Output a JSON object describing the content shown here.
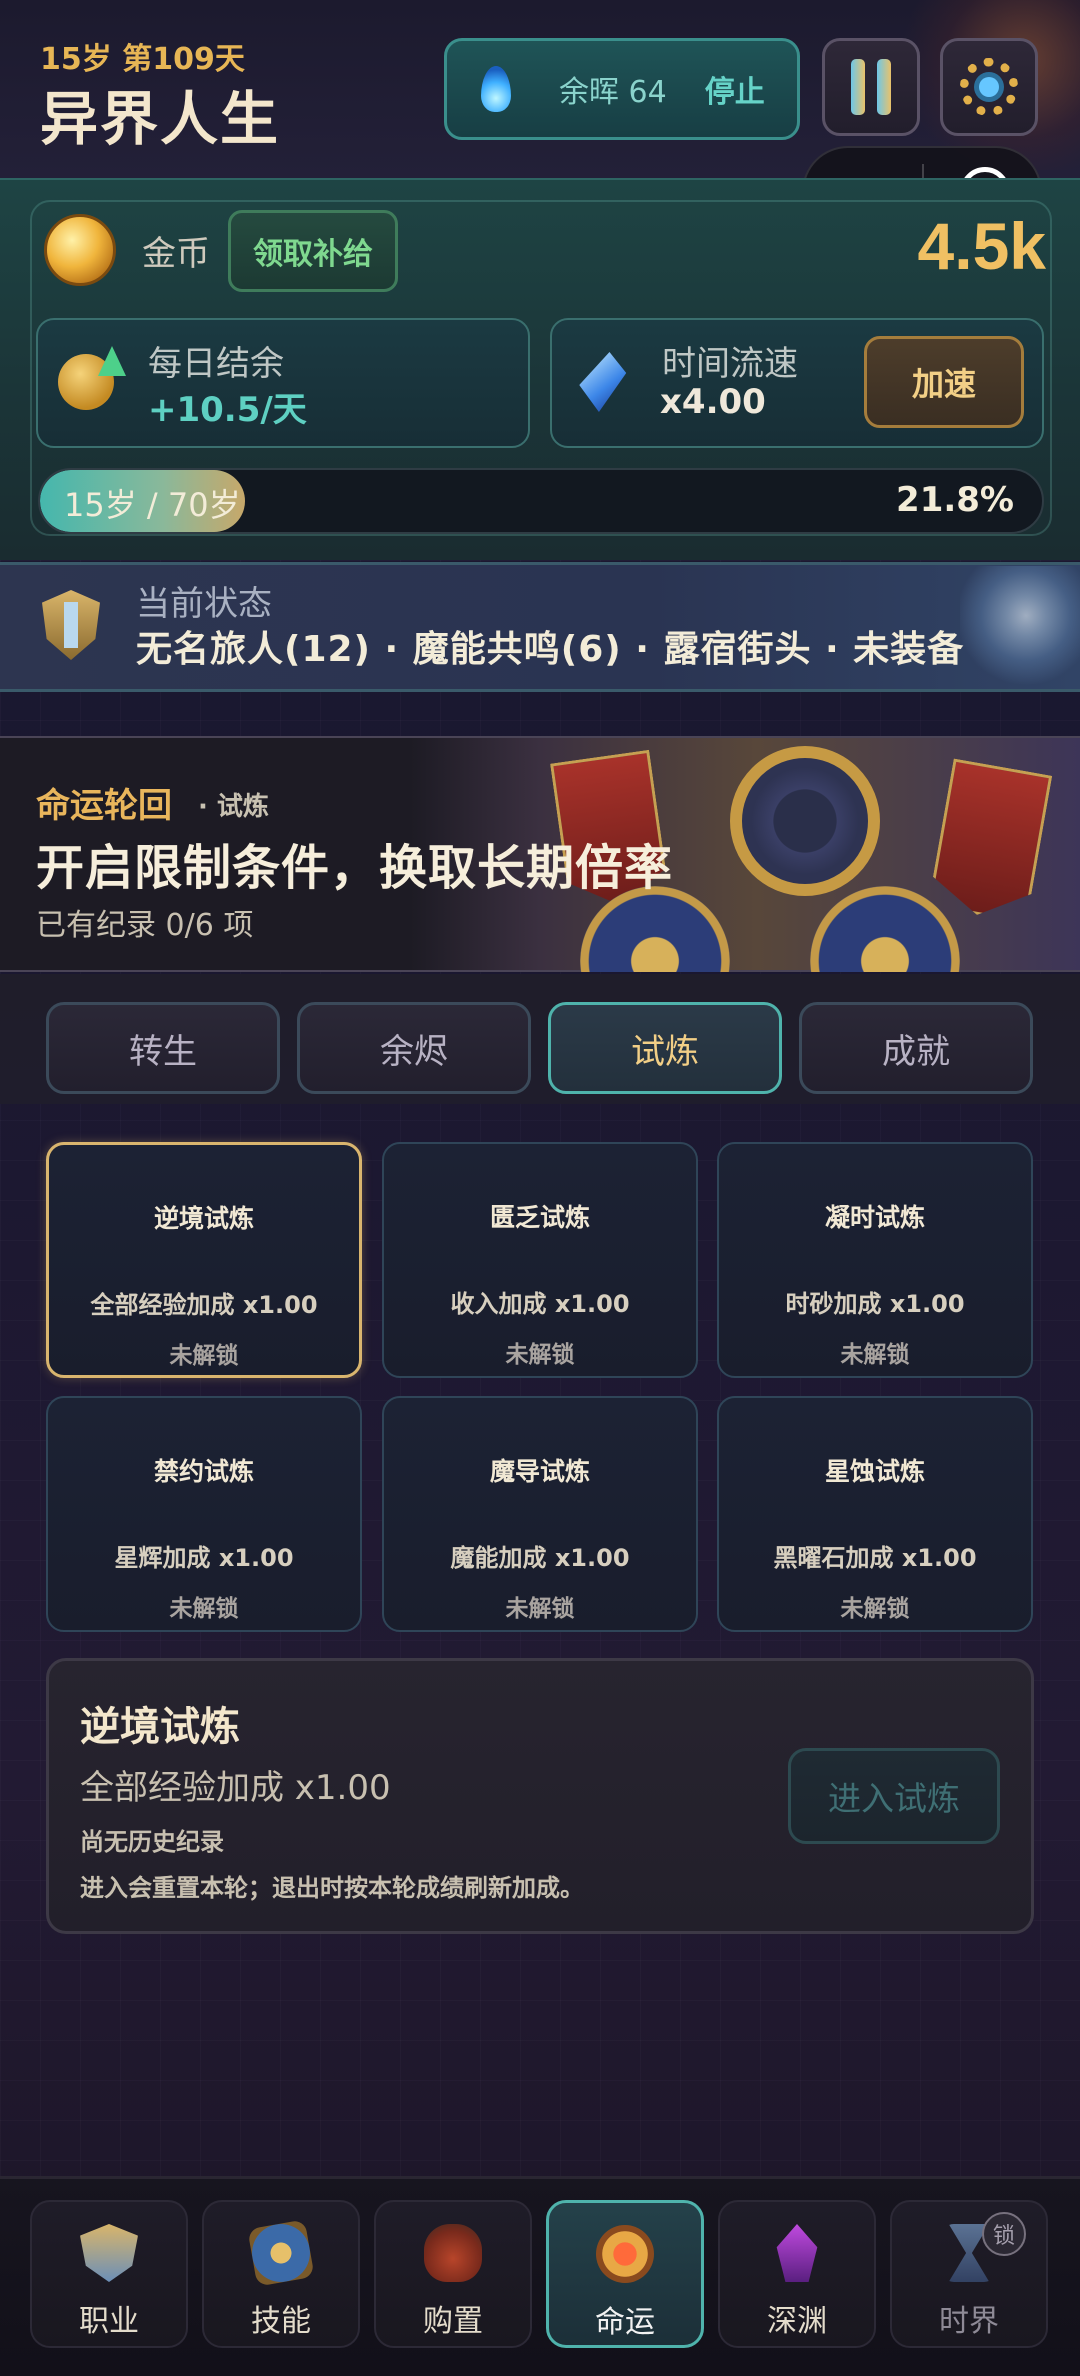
{
  "header": {
    "age_day": "15岁 第109天",
    "title": "异界人生",
    "ember_label": "余晖 64",
    "stop_label": "停止"
  },
  "gold": {
    "label": "金币",
    "claim_label": "领取补给",
    "value": "4.5k"
  },
  "daily": {
    "label": "每日结余",
    "value": "+10.5/天"
  },
  "speed": {
    "label": "时间流速",
    "value": "x4.00",
    "boost_label": "加速"
  },
  "life": {
    "text": "15岁 / 70岁",
    "percent_text": "21.8%",
    "fill_fraction": 0.205
  },
  "status": {
    "label": "当前状态",
    "value": "无名旅人(12) · 魔能共鸣(6) · 露宿街头 · 未装备"
  },
  "banner": {
    "tag": "命运轮回",
    "sub": "· 试炼",
    "title": "开启限制条件，换取长期倍率",
    "note": "已有纪录 0/6 项"
  },
  "tabs": [
    {
      "label": "转生",
      "active": false
    },
    {
      "label": "余烬",
      "active": false
    },
    {
      "label": "试炼",
      "active": true
    },
    {
      "label": "成就",
      "active": false
    }
  ],
  "trials": [
    {
      "name": "逆境试炼",
      "bonus": "全部经验加成 x1.00",
      "status": "未解锁"
    },
    {
      "name": "匮乏试炼",
      "bonus": "收入加成 x1.00",
      "status": "未解锁"
    },
    {
      "name": "凝时试炼",
      "bonus": "时砂加成 x1.00",
      "status": "未解锁"
    },
    {
      "name": "禁约试炼",
      "bonus": "星辉加成 x1.00",
      "status": "未解锁"
    },
    {
      "name": "魔导试炼",
      "bonus": "魔能加成 x1.00",
      "status": "未解锁"
    },
    {
      "name": "星蚀试炼",
      "bonus": "黑曜石加成 x1.00",
      "status": "未解锁"
    }
  ],
  "detail": {
    "title": "逆境试炼",
    "bonus": "全部经验加成 x1.00",
    "history": "尚无历史纪录",
    "note": "进入会重置本轮；退出时按本轮成绩刷新加成。",
    "enter_label": "进入试炼"
  },
  "nav": [
    {
      "label": "职业",
      "icon": "sword-shield-icon"
    },
    {
      "label": "技能",
      "icon": "skill-book-icon"
    },
    {
      "label": "购置",
      "icon": "shop-bag-icon"
    },
    {
      "label": "命运",
      "icon": "fate-sun-icon",
      "active": true
    },
    {
      "label": "深渊",
      "icon": "abyss-crystal-icon"
    },
    {
      "label": "时界",
      "icon": "hourglass-icon",
      "locked": true,
      "badge": "锁"
    }
  ],
  "colors": {
    "accent_teal": "#4fb3ac",
    "accent_gold": "#e9b65c",
    "gold_value": "#f0c063",
    "positive_green": "#5ed0c2"
  }
}
